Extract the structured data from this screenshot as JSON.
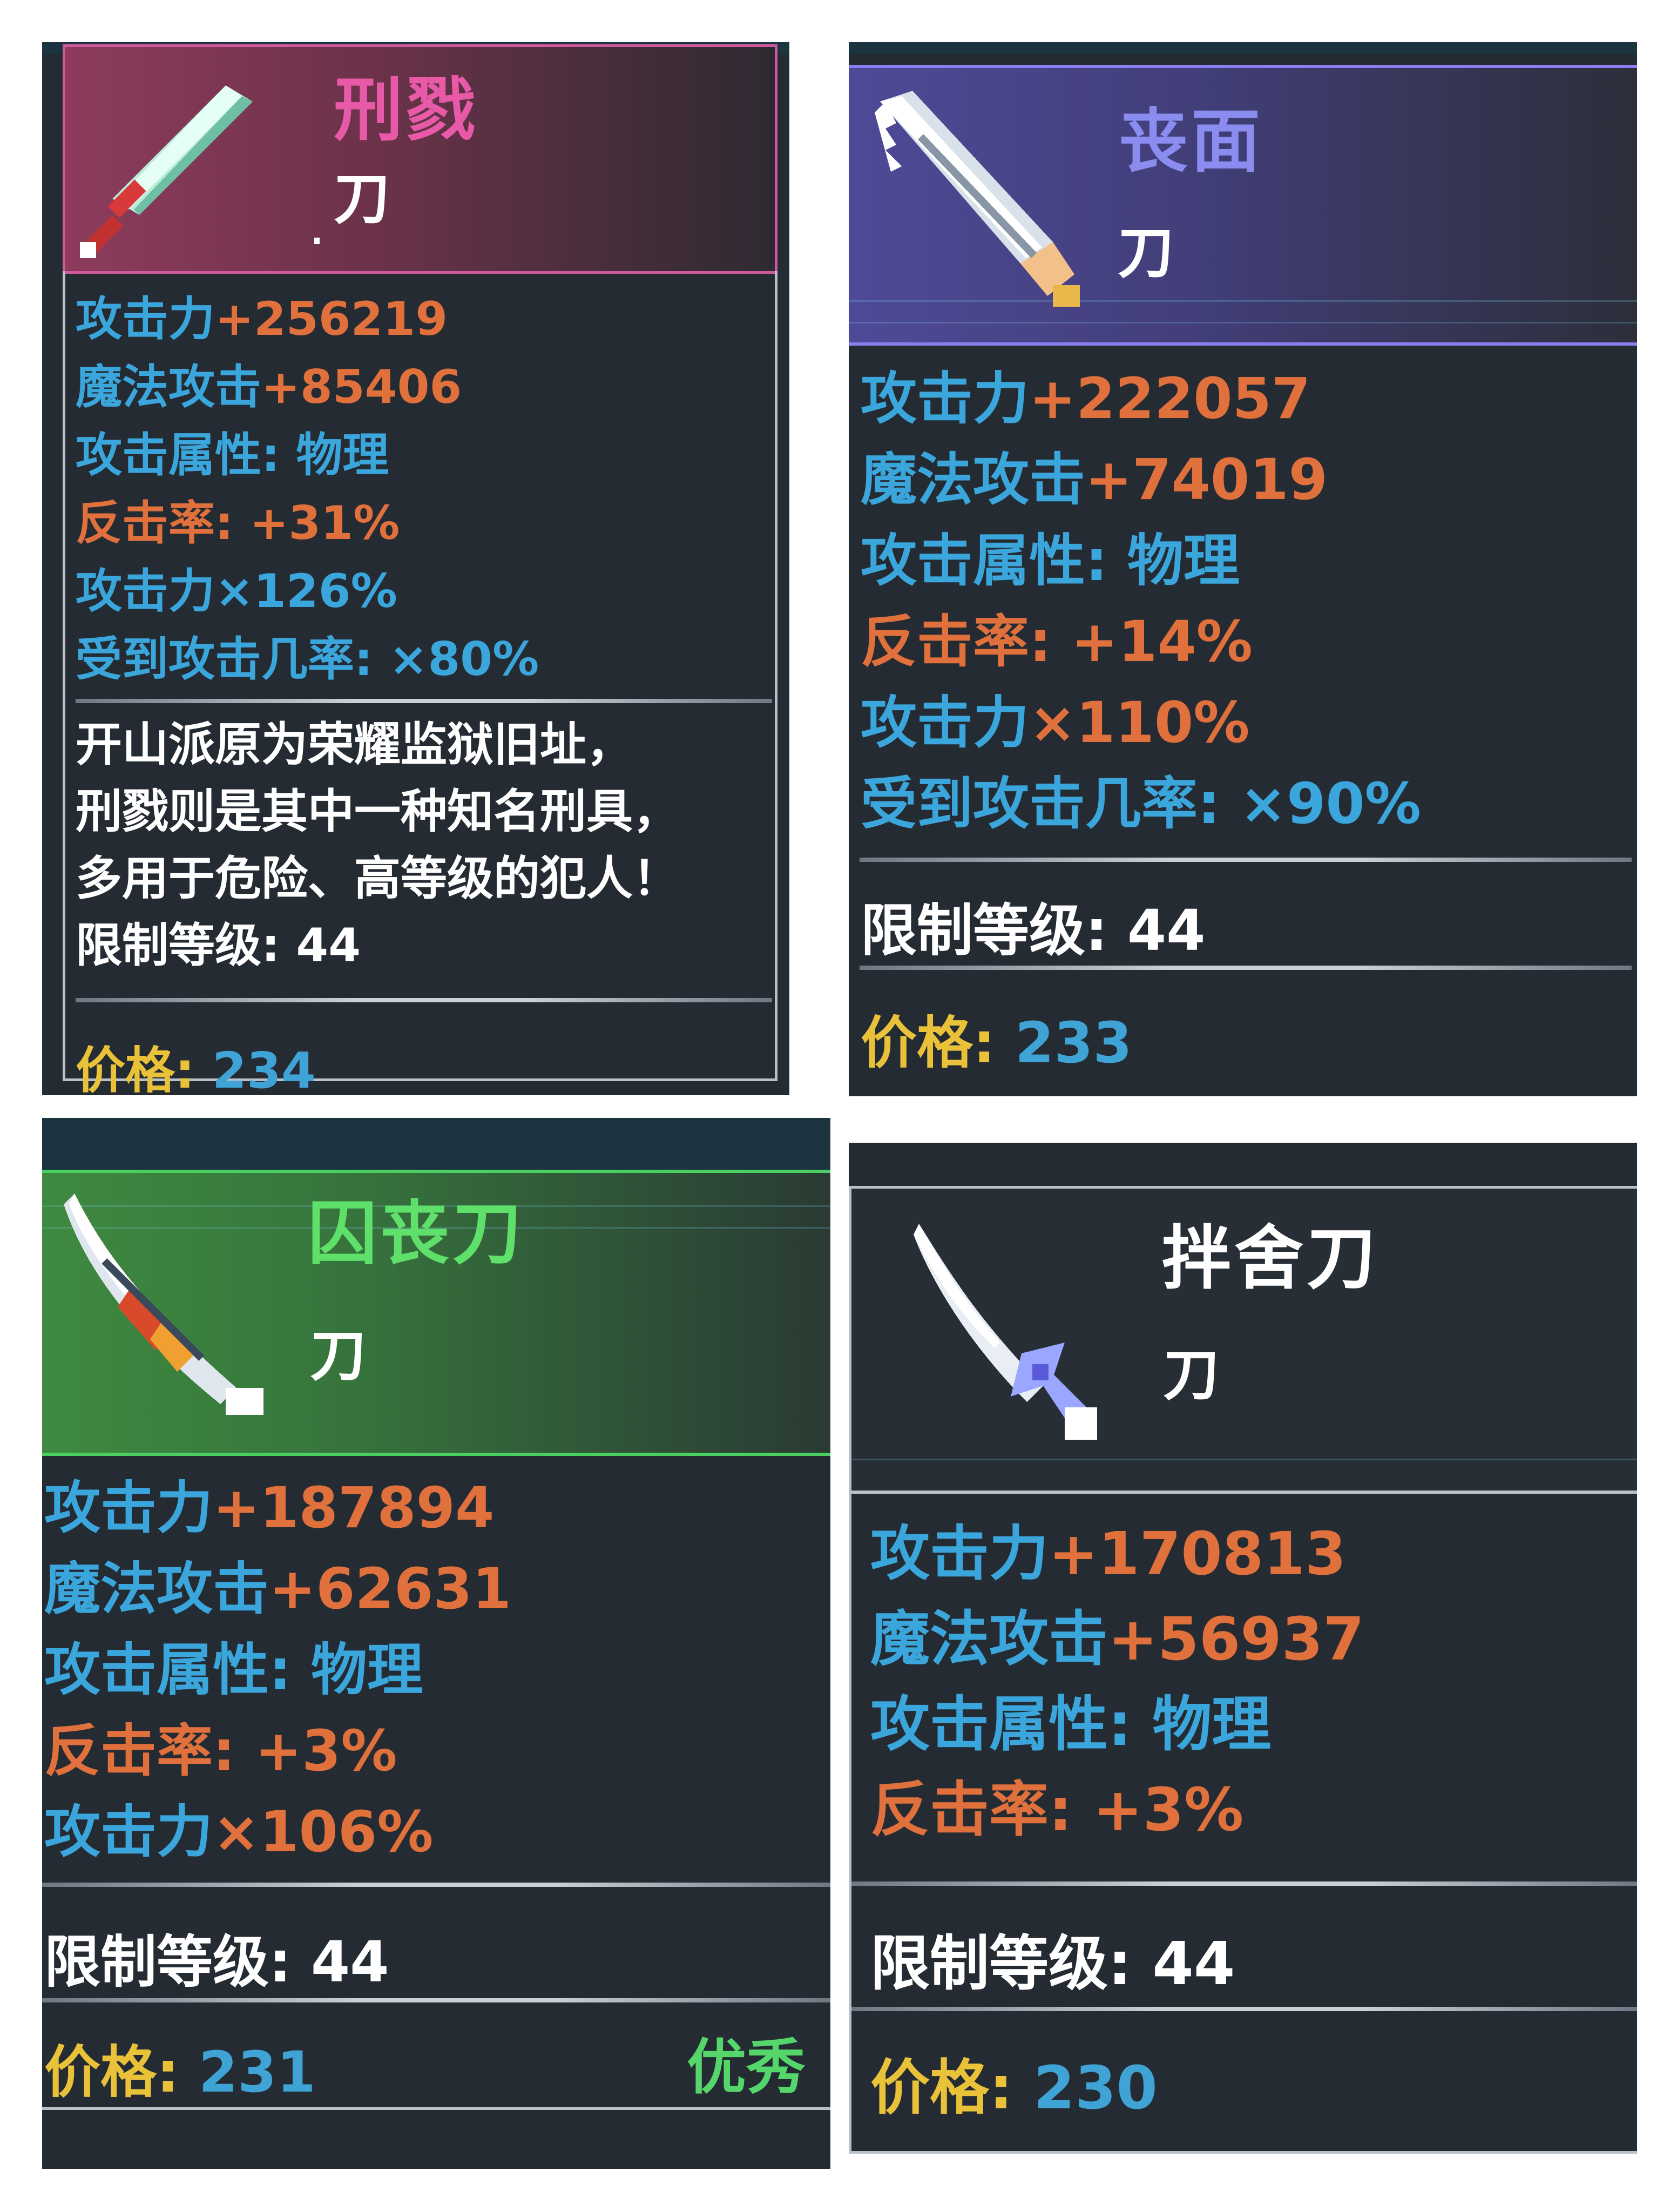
{
  "stat_labels": {
    "atk": "攻击力",
    "matk": "魔法攻击",
    "attr": "攻击属性:",
    "counter": "反击率:",
    "atk_mult": "攻击力",
    "hit_rate": "受到攻击几率:"
  },
  "common": {
    "req_label": "限制等级:",
    "price_label": "价格:"
  },
  "colors": {
    "stat_label_blue": "#3aa6dc",
    "stat_value_orange": "#e0703c",
    "price_label_yellow": "#e9c23a",
    "card_bg": "#252b33",
    "quality_green": "#54d66a"
  },
  "items": [
    {
      "title": "刑戮",
      "title_color": "#e85aa8",
      "subtype": "刀",
      "icon": "pixel-sword-icon",
      "atk": "+256219",
      "matk": "+85406",
      "attr_value": "物理",
      "counter_value": "+31%",
      "atk_mult": "×126%",
      "hit_rate": "×80%",
      "desc": [
        "开山派原为荣耀监狱旧址，",
        "刑戮则是其中一种知名刑具，",
        "多用于危险、高等级的犯人！"
      ],
      "req_value": "44",
      "price_value": "234"
    },
    {
      "title": "丧面",
      "title_color": "#8a8cf0",
      "subtype": "刀",
      "icon": "serrated-blade-icon",
      "atk": "+222057",
      "matk": "+74019",
      "attr_value": "物理",
      "counter_value": "+14%",
      "atk_mult": "×110%",
      "hit_rate": "×90%",
      "req_value": "44",
      "price_value": "233"
    },
    {
      "title": "囚丧刀",
      "title_color": "#5fe06a",
      "subtype": "刀",
      "icon": "curved-saber-icon",
      "atk": "+187894",
      "matk": "+62631",
      "attr_value": "物理",
      "counter_value": "+3%",
      "atk_mult": "×106%",
      "req_value": "44",
      "price_value": "231",
      "quality": "优秀"
    },
    {
      "title": "拌舍刀",
      "title_color": "#ffffff",
      "subtype": "刀",
      "icon": "short-dagger-icon",
      "atk": "+170813",
      "matk": "+56937",
      "attr_value": "物理",
      "counter_value": "+3%",
      "req_value": "44",
      "price_value": "230"
    }
  ]
}
